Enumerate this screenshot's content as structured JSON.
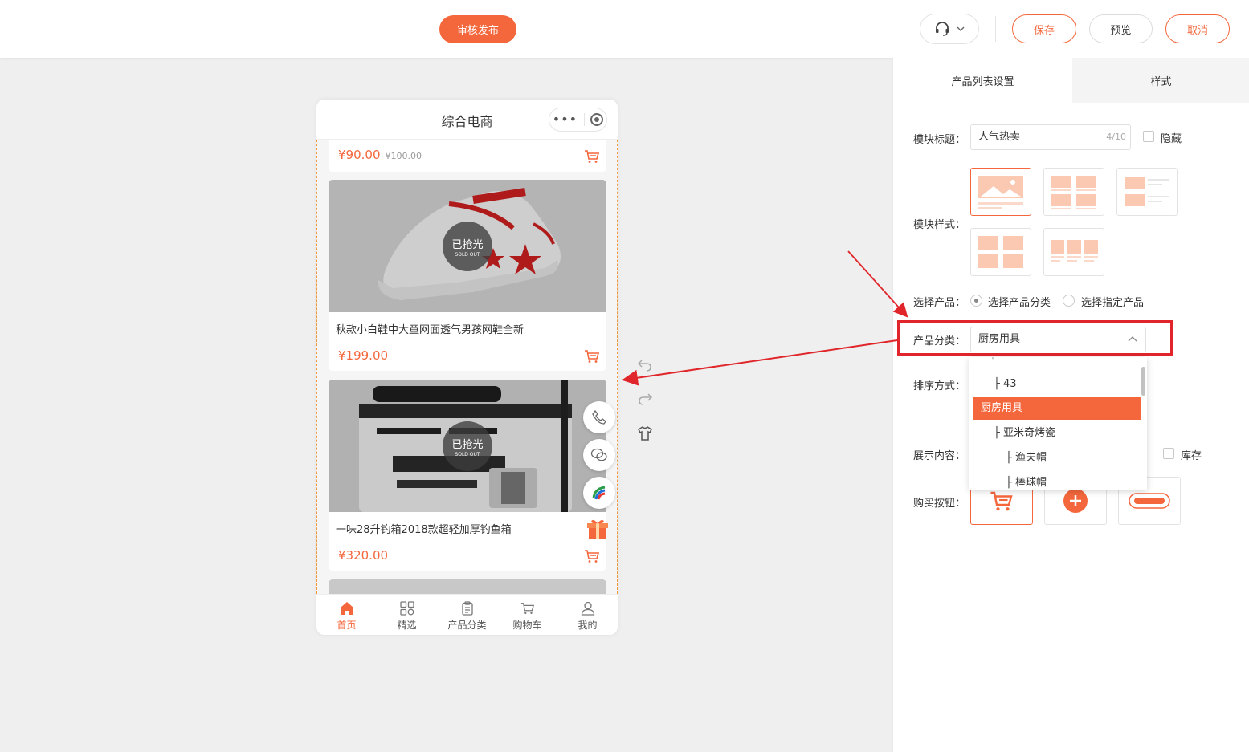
{
  "toolbar": {
    "publish_label": "审核发布",
    "save_label": "保存",
    "preview_label": "预览",
    "cancel_label": "取消"
  },
  "phone": {
    "title": "综合电商",
    "products": [
      {
        "price": "¥90.00",
        "old_price": "¥100.00"
      },
      {
        "name": "秋款小白鞋中大童网面透气男孩网鞋全新",
        "price": "¥199.00",
        "badge_cn": "已抢光",
        "badge_en": "SOLD OUT"
      },
      {
        "name": "一味28升钓箱2018款超轻加厚钓鱼箱",
        "price": "¥320.00",
        "badge_cn": "已抢光",
        "badge_en": "SOLD OUT"
      }
    ],
    "nav": [
      {
        "label": "首页",
        "icon": "home-icon"
      },
      {
        "label": "精选",
        "icon": "grid-icon"
      },
      {
        "label": "产品分类",
        "icon": "clipboard-icon"
      },
      {
        "label": "购物车",
        "icon": "cart-icon"
      },
      {
        "label": "我的",
        "icon": "user-icon"
      }
    ]
  },
  "panel": {
    "tabs": [
      "产品列表设置",
      "样式"
    ],
    "module_title_label": "模块标题：",
    "module_title_value": "人气热卖",
    "module_title_count": "4/10",
    "hide_label": "隐藏",
    "module_style_label": "模块样式：",
    "select_product_label": "选择产品：",
    "radio_category": "选择产品分类",
    "radio_specific": "选择指定产品",
    "category_label": "产品分类：",
    "category_value": "厨房用具",
    "sort_label": "排序方式：",
    "display_label": "展示内容：",
    "stock_label": "库存",
    "buy_button_label": "购买按钮：",
    "dropdown_items": [
      "├ 43",
      "厨房用具",
      "├ 亚米奇烤瓷",
      "├ 渔夫帽",
      "├ 棒球帽"
    ]
  },
  "colors": {
    "accent": "#f4673c",
    "annotation": "#e0262b"
  }
}
